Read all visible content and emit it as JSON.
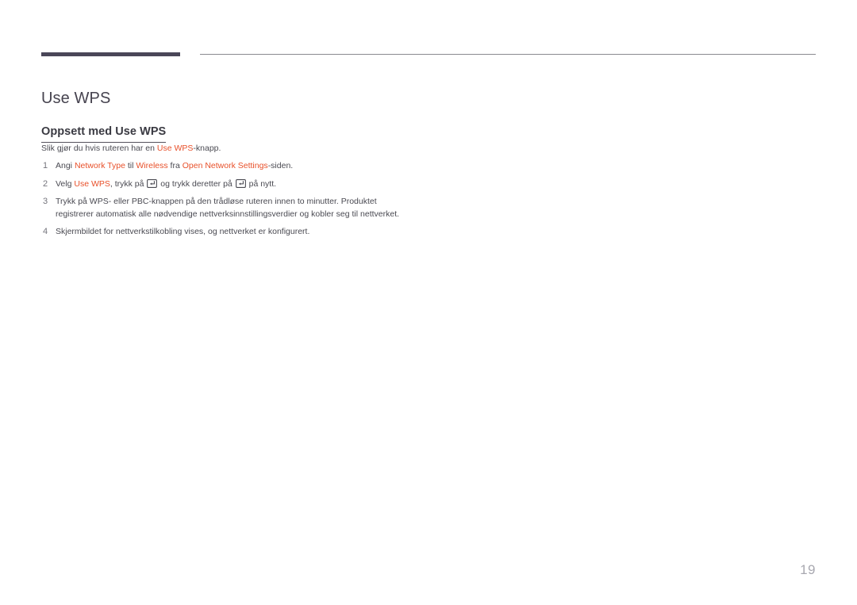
{
  "document": {
    "title": "Use WPS",
    "section_heading": "Oppsett med Use WPS",
    "page_number": "19"
  },
  "colors": {
    "accent": "#e8502a",
    "rule_thick": "#4a4658",
    "rule_thin": "#8a8a90",
    "title": "#46434f",
    "body": "#4a4a52",
    "page_number": "#a8a8b0"
  },
  "body": {
    "intro": {
      "before": "Slik gjør du hvis ruteren har en ",
      "accent": "Use WPS",
      "after": "-knapp."
    },
    "steps": [
      {
        "number": "1",
        "segments": [
          {
            "text": "Angi ",
            "accent": false
          },
          {
            "text": "Network Type",
            "accent": true
          },
          {
            "text": " til ",
            "accent": false
          },
          {
            "text": "Wireless",
            "accent": true
          },
          {
            "text": " fra ",
            "accent": false
          },
          {
            "text": "Open Network Settings",
            "accent": true
          },
          {
            "text": "-siden.",
            "accent": false
          }
        ]
      },
      {
        "number": "2",
        "segments": [
          {
            "text": "Velg ",
            "accent": false
          },
          {
            "text": "Use WPS",
            "accent": true
          },
          {
            "text": ", trykk på ",
            "accent": false
          },
          {
            "icon": "enter-key-icon"
          },
          {
            "text": " og trykk deretter på ",
            "accent": false
          },
          {
            "icon": "enter-key-icon"
          },
          {
            "text": " på nytt.",
            "accent": false
          }
        ]
      },
      {
        "number": "3",
        "segments": [
          {
            "text": "Trykk på WPS- eller PBC-knappen på den trådløse ruteren innen to minutter. Produktet registrerer automatisk alle nødvendige nettverksinnstillingsverdier og kobler seg til nettverket.",
            "accent": false
          }
        ]
      },
      {
        "number": "4",
        "segments": [
          {
            "text": "Skjermbildet for nettverkstilkobling vises, og nettverket er konfigurert.",
            "accent": false
          }
        ]
      }
    ]
  }
}
